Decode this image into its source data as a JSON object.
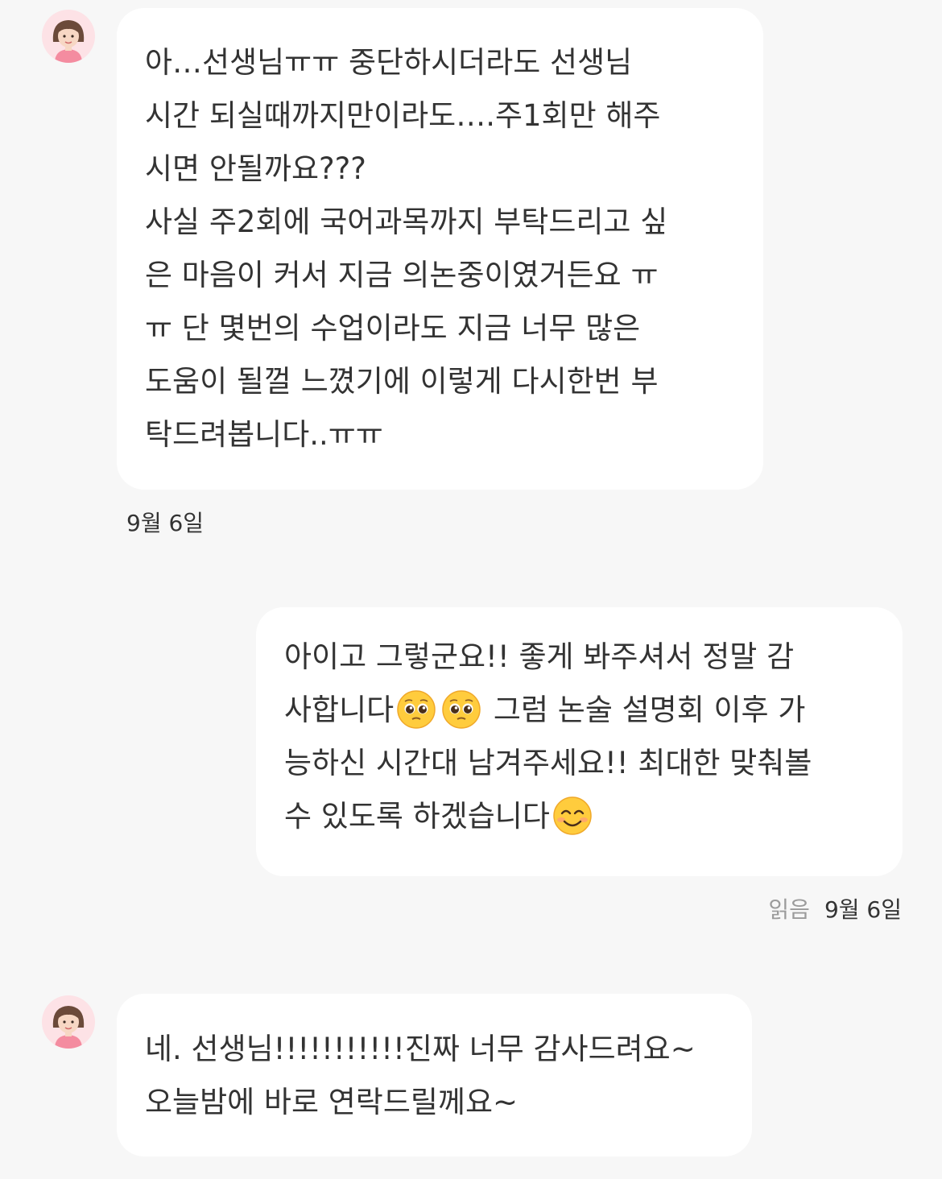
{
  "messages": [
    {
      "sender": "other",
      "lines": [
        "아…선생님ㅠㅠ  중단하시더라도 선생님",
        "시간 되실때까지만이라도….주1회만 해주",
        "시면 안될까요???",
        "사실 주2회에 국어과목까지 부탁드리고 싶",
        "은 마음이 커서 지금 의논중이였거든요 ㅠ",
        "ㅠ 단 몇번의 수업이라도 지금 너무 많은",
        "도움이 될껄 느꼈기에 이렇게 다시한번 부",
        "탁드려봅니다..ㅠㅠ"
      ],
      "date": "9월 6일"
    },
    {
      "sender": "me",
      "line1": "아이고 그렇군요!! 좋게 봐주셔서 정말 감",
      "line2_a": "사합니다",
      "line2_b": " 그럼 논술 설명회 이후 가",
      "line3": "능하신 시간대 남겨주세요!! 최대한 맞춰볼",
      "line4": "수 있도록 하겠습니다",
      "emojis": [
        "pleading-face-emoji",
        "pleading-face-emoji",
        "smiling-face-emoji"
      ],
      "read_label": "읽음",
      "date": "9월 6일"
    },
    {
      "sender": "other",
      "lines": [
        "네. 선생님!!!!!!!!!!!진짜 너무 감사드려요~",
        "오늘밤에 바로 연락드릴께요~"
      ]
    }
  ],
  "colors": {
    "background": "#f7f7f7",
    "bubble": "#ffffff",
    "text": "#333333",
    "read_label": "#9b9b9b",
    "avatar_bg": "#fde2e6"
  }
}
